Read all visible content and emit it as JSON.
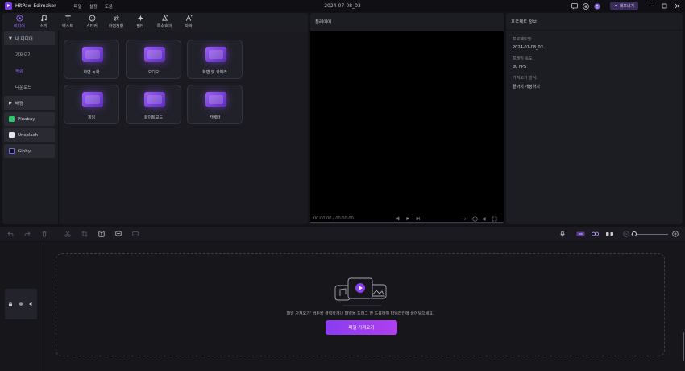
{
  "app": {
    "name": "HitPaw Edimakor",
    "document_title": "2024-07-08_03"
  },
  "menu": [
    "파일",
    "설정",
    "도움"
  ],
  "titlebar": {
    "export_label": "내보내기"
  },
  "toolbar": {
    "tools": [
      {
        "label": "미디어",
        "icon": "media-icon"
      },
      {
        "label": "소리",
        "icon": "audio-icon"
      },
      {
        "label": "텍스트",
        "icon": "text-icon"
      },
      {
        "label": "스티커",
        "icon": "sticker-icon"
      },
      {
        "label": "화면전환",
        "icon": "transition-icon"
      },
      {
        "label": "필터",
        "icon": "filter-icon"
      },
      {
        "label": "특수효과",
        "icon": "effect-icon"
      },
      {
        "label": "자막",
        "icon": "subtitle-icon"
      }
    ]
  },
  "sidebar": {
    "my_media": "내 미디어",
    "import": "가져오기",
    "record": "녹화",
    "download": "다운로드",
    "background": "배경",
    "pixabay": "Pixabay",
    "unsplash": "Unsplash",
    "giphy": "Giphy"
  },
  "record_cards": [
    "화면 녹화",
    "오디오",
    "화면 및 카메라",
    "게임",
    "화이트보드",
    "카메라"
  ],
  "player": {
    "title": "플레이어",
    "time": "00:00:00 / 00:00:00"
  },
  "project": {
    "title": "프로젝트 정보",
    "fields": [
      {
        "key": "프로젝트명:",
        "value": "2024-07-08_03"
      },
      {
        "key": "프레임 속도:",
        "value": "30 FPS"
      },
      {
        "key": "가져오기 방식:",
        "value": "끝까지 개정하기"
      }
    ]
  },
  "timeline": {
    "hint": "파일 가져오기' 버튼을 클릭하거나 파일을 드래그 한 드롭하여 타임라인에 끌어넣으세요.",
    "import_button": "파일 가져오기"
  },
  "colors": {
    "accent": "#8b3cf2",
    "panel": "#1c1c23",
    "background": "#121217"
  }
}
